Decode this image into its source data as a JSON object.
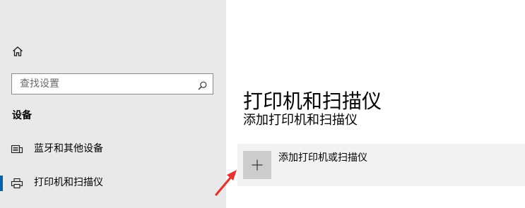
{
  "sidebar": {
    "home_icon": "home-icon",
    "search": {
      "placeholder": "查找设置",
      "icon": "search-icon"
    },
    "section_title": "设备",
    "items": [
      {
        "label": "蓝牙和其他设备",
        "icon": "bluetooth-devices-icon",
        "selected": false
      },
      {
        "label": "打印机和扫描仪",
        "icon": "printer-icon",
        "selected": true
      }
    ]
  },
  "main": {
    "title": "打印机和扫描仪",
    "subsection_title": "添加打印机和扫描仪",
    "add_button": {
      "label": "添加打印机或扫描仪",
      "icon": "plus-icon"
    }
  },
  "annotation": {
    "arrow_icon": "red-pointer-arrow",
    "color": "#e8322c"
  },
  "colors": {
    "sidebar_bg": "#e9e9e9",
    "accent": "#0063b1",
    "add_tile_bg": "#cccccc",
    "add_row_bg": "#f2f2f2"
  }
}
